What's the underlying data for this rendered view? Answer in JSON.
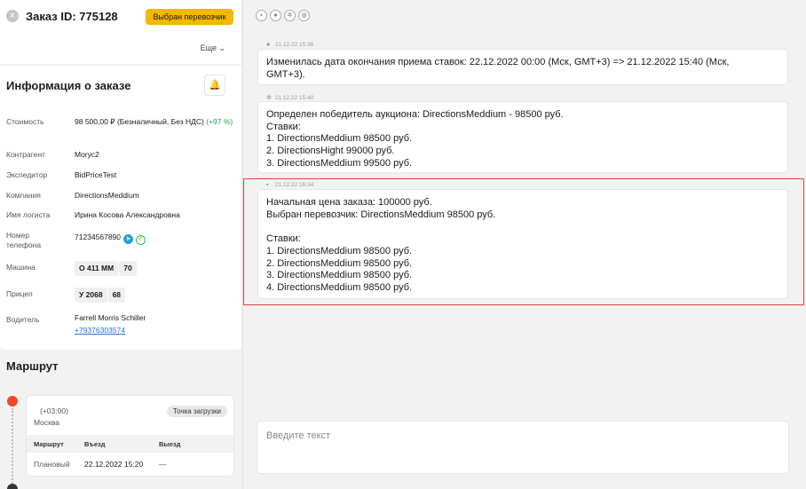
{
  "header": {
    "title": "Заказ ID: 775128",
    "status": "Выбран перевозчик",
    "more_label": "Еще ⌄"
  },
  "info": {
    "title": "Информация о заказе",
    "rows": {
      "cost_label": "Стоимость",
      "cost_value": "98 500,00 ₽ (Безналичный, Без НДС)",
      "cost_delta": "(+97 %)",
      "contractor_label": "Контрагент",
      "contractor_value": "Morус2",
      "forwarder_label": "Экспедитор",
      "forwarder_value": "BidPriceTest",
      "company_label": "Компания",
      "company_value": "DirectionsMeddium",
      "logist_label": "Имя логиста",
      "logist_value": "Ирина Косова Александровна",
      "phone_label_1": "Номер",
      "phone_label_2": "телефона",
      "phone_value": "71234567890",
      "car_label": "Машина",
      "car_plate": "О 411 ММ",
      "car_region": "70",
      "trailer_label": "Прицеп",
      "trailer_plate": "У 2068",
      "trailer_region": "68",
      "driver_label": "Водитель",
      "driver_name": "Farrell Morris Schiller",
      "driver_phone": "+79376303574"
    }
  },
  "route": {
    "title": "Маршрут",
    "timezone": "(+03:00)",
    "city": "Москва",
    "badge": "Точка загрузки",
    "table_headers": [
      "Маршрут",
      "Въезд",
      "Выезд"
    ],
    "table_row": [
      "Плановый",
      "22.12.2022 15:20",
      "—"
    ]
  },
  "messages": [
    {
      "time": "21.12.22 15:36",
      "lines": [
        "Изменилась дата окончания приема ставок: 22.12.2022 00:00 (Мск, GMT+3) => 21.12.2022 15:40 (Мск,",
        "GMT+3)."
      ]
    },
    {
      "time": "21.12.22 15:40",
      "lines": [
        "Определен победитель аукциона: DirectionsMeddium - 98500 руб.",
        "Ставки:",
        "1. DirectionsMeddium 98500 руб.",
        "2. DirectionsHight 99000 руб.",
        "3. DirectionsMeddium 99500 руб."
      ]
    },
    {
      "time": "21.12.22 16:34",
      "lines": [
        "Начальная цена заказа: 100000 руб.",
        "Выбран перевозчик: DirectionsMeddium 98500 руб.",
        "",
        "Ставки:",
        "1. DirectionsMeddium 98500 руб.",
        "2. DirectionsMeddium 98500 руб.",
        "3. DirectionsMeddium 98500 руб.",
        "4. DirectionsMeddium 98500 руб."
      ]
    }
  ],
  "composer": {
    "placeholder": "Введите текст"
  },
  "colors": {
    "accent": "#f5b700",
    "highlight": "#e0433c",
    "link": "#2a6edb",
    "route_start": "#f04a23"
  }
}
